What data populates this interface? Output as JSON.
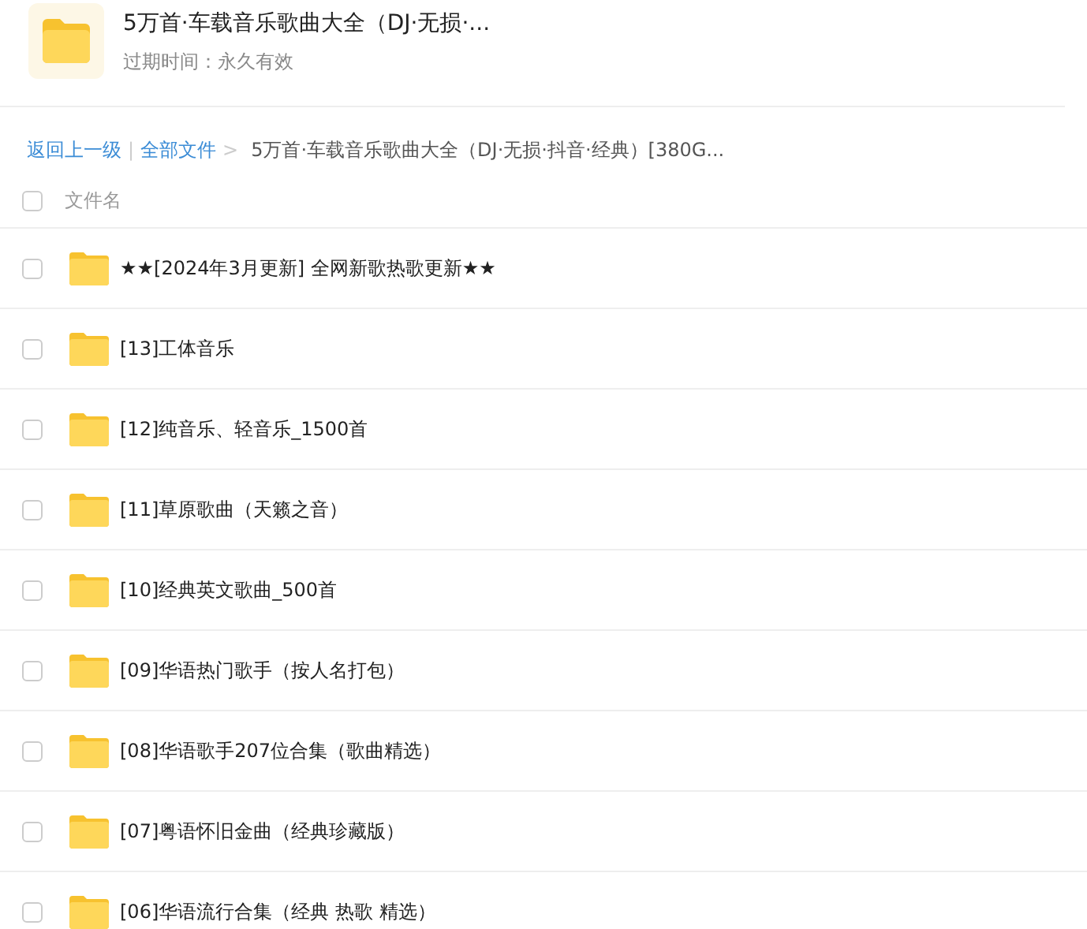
{
  "share": {
    "title": "5万首·车载音乐歌曲大全（DJ·无损·...",
    "expiry": "过期时间：永久有效"
  },
  "breadcrumb": {
    "back": "返回上一级",
    "separator": "|",
    "root": "全部文件",
    "arrow": ">",
    "current": "5万首·车载音乐歌曲大全（DJ·无损·抖音·经典）[380G..."
  },
  "table": {
    "select_all_checked": false,
    "column_header": "文件名",
    "rows": [
      {
        "name": "★★[2024年3月更新] 全网新歌热歌更新★★",
        "checked": false
      },
      {
        "name": "[13]工体音乐",
        "checked": false
      },
      {
        "name": "[12]纯音乐、轻音乐_1500首",
        "checked": false
      },
      {
        "name": "[11]草原歌曲（天籁之音）",
        "checked": false
      },
      {
        "name": "[10]经典英文歌曲_500首",
        "checked": false
      },
      {
        "name": "[09]华语热门歌手（按人名打包）",
        "checked": false
      },
      {
        "name": "[08]华语歌手207位合集（歌曲精选）",
        "checked": false
      },
      {
        "name": "[07]粤语怀旧金曲（经典珍藏版）",
        "checked": false
      },
      {
        "name": "[06]华语流行合集（经典 热歌 精选）",
        "checked": false
      }
    ]
  }
}
